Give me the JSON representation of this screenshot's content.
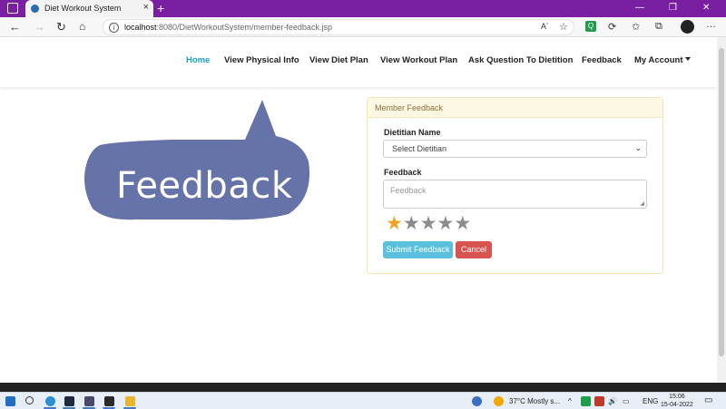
{
  "browser": {
    "tab_title": "Diet Workout System",
    "tab_close": "×",
    "new_tab": "+",
    "url_host": "localhost",
    "url_rest": ":8080/DietWorkoutSystem/member-feedback.jsp",
    "read_aloud": "Aʼ",
    "window_controls": [
      "—",
      "❐",
      "✕"
    ]
  },
  "nav": {
    "items": [
      {
        "label": "Home",
        "active": true
      },
      {
        "label": "View Physical Info",
        "active": false
      },
      {
        "label": "View Diet Plan",
        "active": false
      },
      {
        "label": "View Workout Plan",
        "active": false
      },
      {
        "label": "Ask Question To Dietition",
        "active": false
      },
      {
        "label": "Feedback",
        "active": false
      },
      {
        "label": "My Account",
        "active": false
      }
    ]
  },
  "graphic": {
    "word": "Feedback",
    "fill": "#6673a8"
  },
  "panel": {
    "heading": "Member Feedback",
    "dietitian_label": "Dietitian Name",
    "dietitian_selected": "Select Dietitian",
    "feedback_label": "Feedback",
    "feedback_placeholder": "Feedback",
    "rating": 1,
    "max_rating": 5,
    "submit_label": "Submit Feedback",
    "cancel_label": "Cancel"
  },
  "taskbar": {
    "weather": "37°C  Mostly s...",
    "language": "ENG",
    "time": "15:06",
    "date": "15-04-2022"
  },
  "colors": {
    "tab_strip": "#7a1fa2",
    "nav_active": "#1aa0d4",
    "submit": "#5bc0de",
    "cancel": "#d9534f",
    "star_on": "#f0a325",
    "star_off": "#8c8c8c",
    "panel_heading_bg": "#fcf8e3"
  }
}
